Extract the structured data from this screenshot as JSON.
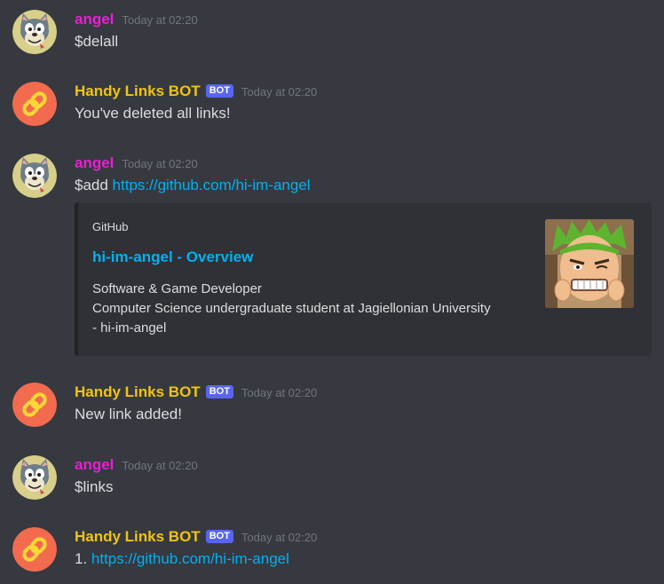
{
  "messages": [
    {
      "author": "angel",
      "timestamp": "Today at 02:20",
      "text": "$delall"
    },
    {
      "author": "Handy Links BOT",
      "bot_tag": "BOT",
      "timestamp": "Today at 02:20",
      "text": "You've deleted all links!"
    },
    {
      "author": "angel",
      "timestamp": "Today at 02:20",
      "text_prefix": "$add ",
      "link": "https://github.com/hi-im-angel",
      "embed": {
        "provider": "GitHub",
        "title": "hi-im-angel - Overview",
        "description_lines": [
          "Software & Game Developer",
          "Computer Science undergraduate student at Jagiellonian University",
          "- hi-im-angel"
        ]
      }
    },
    {
      "author": "Handy Links BOT",
      "bot_tag": "BOT",
      "timestamp": "Today at 02:20",
      "text": "New link added!"
    },
    {
      "author": "angel",
      "timestamp": "Today at 02:20",
      "text": "$links"
    },
    {
      "author": "Handy Links BOT",
      "bot_tag": "BOT",
      "timestamp": "Today at 02:20",
      "text_prefix": "1. ",
      "link": "https://github.com/hi-im-angel"
    }
  ],
  "colors": {
    "background": "#36393f",
    "user_name": "#e91ed6",
    "bot_name": "#f1c40f",
    "bot_tag": "#5865f2",
    "link": "#00b0f4",
    "timestamp": "#72767d",
    "embed_background": "#2f3136",
    "bot_avatar": "#f26b4f"
  },
  "icons": {
    "user_avatar": "cartoon-cat-avatar",
    "bot_avatar": "chain-link-icon",
    "embed_thumbnail": "anime-character-thumbnail"
  }
}
